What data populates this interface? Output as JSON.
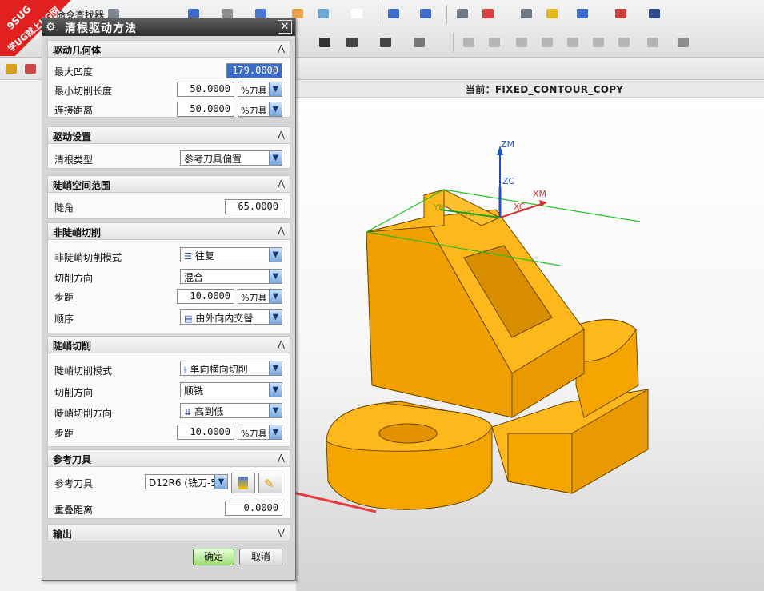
{
  "toolbar": {
    "top_label": "命令查找器",
    "icons": [
      "op-icon",
      "create-geom-icon",
      "refresh-icon",
      "box-icon",
      "folder-icon",
      "view-icon",
      "rect-icon",
      "tool-path-icon",
      "verify-icon",
      "list-icon",
      "mcs-icon",
      "gear-tool-icon",
      "simulate-icon",
      "machine-icon",
      "measure-icon",
      "ruler-icon"
    ]
  },
  "statusbar": {
    "current_label": "当前：FIXED_CONTOUR_COPY"
  },
  "watermark": {
    "line1": "9SUG",
    "line2": "学UG就上UG网"
  },
  "dialog": {
    "title": "清根驱动方法",
    "ok": "确定",
    "cancel": "取消",
    "sections": {
      "drive_geometry": {
        "title": "驱动几何体",
        "max_concavity_label": "最大凹度",
        "max_concavity_value": "179.0000",
        "min_cut_length_label": "最小切削长度",
        "min_cut_length_value": "50.0000",
        "min_cut_length_unit": "%刀具",
        "link_distance_label": "连接距离",
        "link_distance_value": "50.0000",
        "link_distance_unit": "%刀具"
      },
      "drive_settings": {
        "title": "驱动设置",
        "cleanup_type_label": "清根类型",
        "cleanup_type_value": "参考刀具偏置"
      },
      "steep_range": {
        "title": "陡峭空间范围",
        "steep_angle_label": "陡角",
        "steep_angle_value": "65.0000"
      },
      "non_steep": {
        "title": "非陡峭切削",
        "pattern_label": "非陡峭切削模式",
        "pattern_value": "往复",
        "direction_label": "切削方向",
        "direction_value": "混合",
        "stepover_label": "步距",
        "stepover_value": "10.0000",
        "stepover_unit": "%刀具",
        "order_label": "顺序",
        "order_value": "由外向内交替"
      },
      "steep": {
        "title": "陡峭切削",
        "pattern_label": "陡峭切削模式",
        "pattern_value": "单向横向切削",
        "direction_label": "切削方向",
        "direction_value": "顺铣",
        "steep_dir_label": "陡峭切削方向",
        "steep_dir_value": "高到低",
        "stepover_label": "步距",
        "stepover_value": "10.0000",
        "stepover_unit": "%刀具"
      },
      "reference_tool": {
        "title": "参考刀具",
        "tool_label": "参考刀具",
        "tool_value": "D12R6 (铣刀-5",
        "overlap_label": "重叠距离",
        "overlap_value": "0.0000"
      },
      "output": {
        "title": "输出"
      }
    }
  },
  "axes": {
    "zm": "ZM",
    "zc": "ZC",
    "xm": "XM",
    "xc": "XC",
    "yc": "YC",
    "ym": "YM"
  },
  "colors": {
    "part": "#f5a500",
    "part_dark": "#c98600",
    "arrow": "#e83c3c",
    "axis_blue": "#1a4fd6",
    "axis_red": "#d83030",
    "axis_green": "#22c022"
  }
}
